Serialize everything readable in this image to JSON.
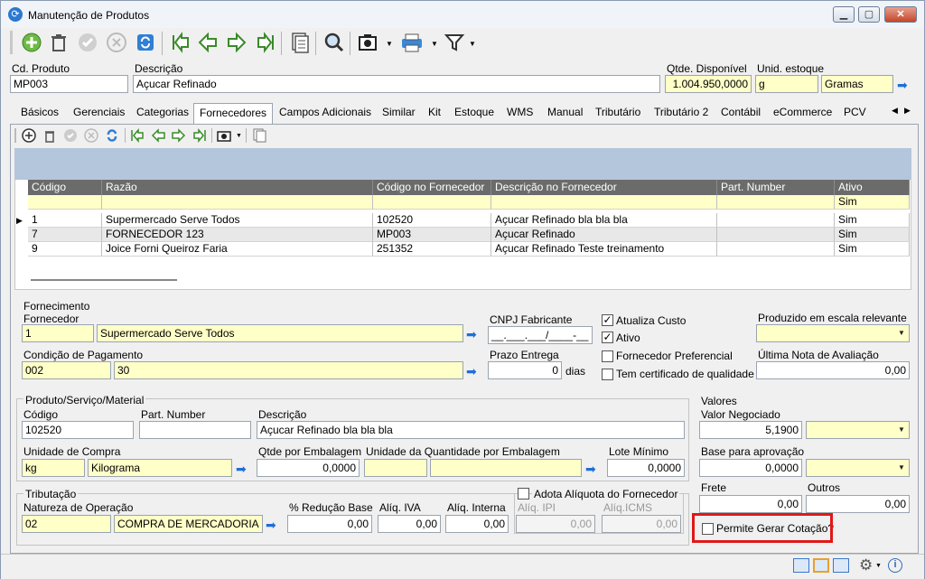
{
  "window": {
    "title": "Manutenção de Produtos",
    "min": "▁",
    "max": "▢",
    "close": "✕"
  },
  "header": {
    "cd_produto_label": "Cd. Produto",
    "cd_produto_value": "MP003",
    "descricao_label": "Descrição",
    "descricao_value": "Açucar Refinado",
    "qtde_label": "Qtde. Disponível",
    "qtde_value": "1.004.950,0000",
    "unid_label": "Unid. estoque",
    "unid_code": "g",
    "unid_name": "Gramas"
  },
  "tabs": [
    "Básicos",
    "Gerenciais",
    "Categorias",
    "Fornecedores",
    "Campos Adicionais",
    "Similar",
    "Kit",
    "Estoque",
    "WMS",
    "Manual",
    "Tributário",
    "Tributário 2",
    "Contábil",
    "eCommerce",
    "PCV"
  ],
  "active_tab": "Fornecedores",
  "grid": {
    "columns": [
      "Código",
      "Razão",
      "Código no Fornecedor",
      "Descrição no Fornecedor",
      "Part. Number",
      "Ativo"
    ],
    "filter_row": [
      "",
      "",
      "",
      "",
      "",
      "Sim"
    ],
    "rows": [
      [
        "1",
        "Supermercado Serve Todos",
        "102520",
        "Açucar Refinado bla bla bla",
        "",
        "Sim"
      ],
      [
        "7",
        "FORNECEDOR 123",
        "MP003",
        "Açucar Refinado",
        "",
        "Sim"
      ],
      [
        "9",
        "Joice Forni Queiroz Faria",
        "251352",
        "Açucar Refinado Teste treinamento",
        "",
        "Sim"
      ]
    ]
  },
  "fornecimento": {
    "group_label": "Fornecimento",
    "fornecedor_label": "Fornecedor",
    "fornecedor_code": "1",
    "fornecedor_name": "Supermercado Serve Todos",
    "cnpj_label": "CNPJ Fabricante",
    "cnpj_value": "__.___.___/____-__",
    "atualiza_custo": "Atualiza Custo",
    "ativo": "Ativo",
    "fornecedor_preferencial": "Fornecedor Preferencial",
    "tem_certificado": "Tem certificado de qualidade",
    "produzido_label": "Produzido em escala relevante",
    "condicao_label": "Condição de Pagamento",
    "condicao_code": "002",
    "condicao_name": "30",
    "prazo_label": "Prazo Entrega",
    "prazo_value": "0",
    "prazo_unit": "dias",
    "ultima_nota_label": "Última Nota de Avaliação",
    "ultima_nota_value": "0,00"
  },
  "produto": {
    "group_label": "Produto/Serviço/Material",
    "codigo_label": "Código",
    "codigo_value": "102520",
    "part_label": "Part. Number",
    "part_value": "",
    "descricao_label": "Descrição",
    "descricao_value": "Açucar Refinado bla bla bla",
    "unidade_label": "Unidade de Compra",
    "unidade_code": "kg",
    "unidade_name": "Kilograma",
    "qtde_emb_label": "Qtde por Embalagem",
    "qtde_emb_value": "0,0000",
    "unid_qtde_emb_label": "Unidade da Quantidade por Embalagem",
    "lote_label": "Lote Mínimo",
    "lote_value": "0,0000"
  },
  "tributacao": {
    "group_label": "Tributação",
    "natureza_label": "Natureza de Operação",
    "natureza_code": "02",
    "natureza_name": "COMPRA DE MERCADORIA",
    "reducao_label": "% Redução Base",
    "reducao_value": "0,00",
    "iva_label": "Alíq. IVA",
    "iva_value": "0,00",
    "interna_label": "Alíq. Interna",
    "interna_value": "0,00",
    "adota_label": "Adota Alíquota do Fornecedor",
    "ipi_label": "Alíq. IPI",
    "ipi_value": "0,00",
    "icms_label": "Alíq.ICMS",
    "icms_value": "0,00"
  },
  "valores": {
    "group_label": "Valores",
    "negociado_label": "Valor Negociado",
    "negociado_value": "5,1900",
    "base_label": "Base para aprovação",
    "base_value": "0,0000",
    "frete_label": "Frete",
    "frete_value": "0,00",
    "outros_label": "Outros",
    "outros_value": "0,00",
    "permite_label": "Permite Gerar Cotação?"
  },
  "colors": {
    "highlight": "#e01818",
    "input_yellow": "#ffffc8",
    "grid_band": "#b4c6dc",
    "grid_header": "#6b6b6b"
  }
}
